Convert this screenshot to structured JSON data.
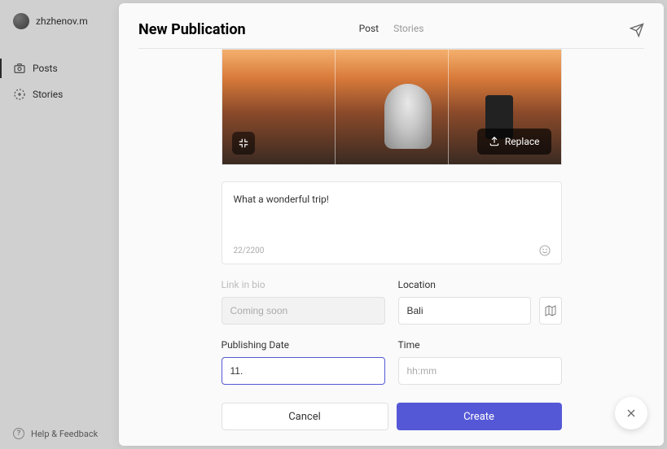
{
  "sidebar": {
    "username": "zhzhenov.m",
    "nav": [
      {
        "icon": "camera-icon",
        "label": "Posts"
      },
      {
        "icon": "plus-circle-icon",
        "label": "Stories"
      }
    ],
    "help_label": "Help & Feedback"
  },
  "modal": {
    "title": "New Publication",
    "tabs": [
      {
        "label": "Post",
        "active": true
      },
      {
        "label": "Stories",
        "active": false
      }
    ],
    "image": {
      "replace_label": "Replace"
    },
    "caption": {
      "text": "What a wonderful trip!",
      "count": "22/2200"
    },
    "fields": {
      "link_label": "Link in bio",
      "link_placeholder": "Coming soon",
      "location_label": "Location",
      "location_value": "Bali",
      "date_label": "Publishing Date",
      "date_value": "11.",
      "time_label": "Time",
      "time_placeholder": "hh:mm"
    },
    "buttons": {
      "cancel": "Cancel",
      "create": "Create"
    }
  }
}
